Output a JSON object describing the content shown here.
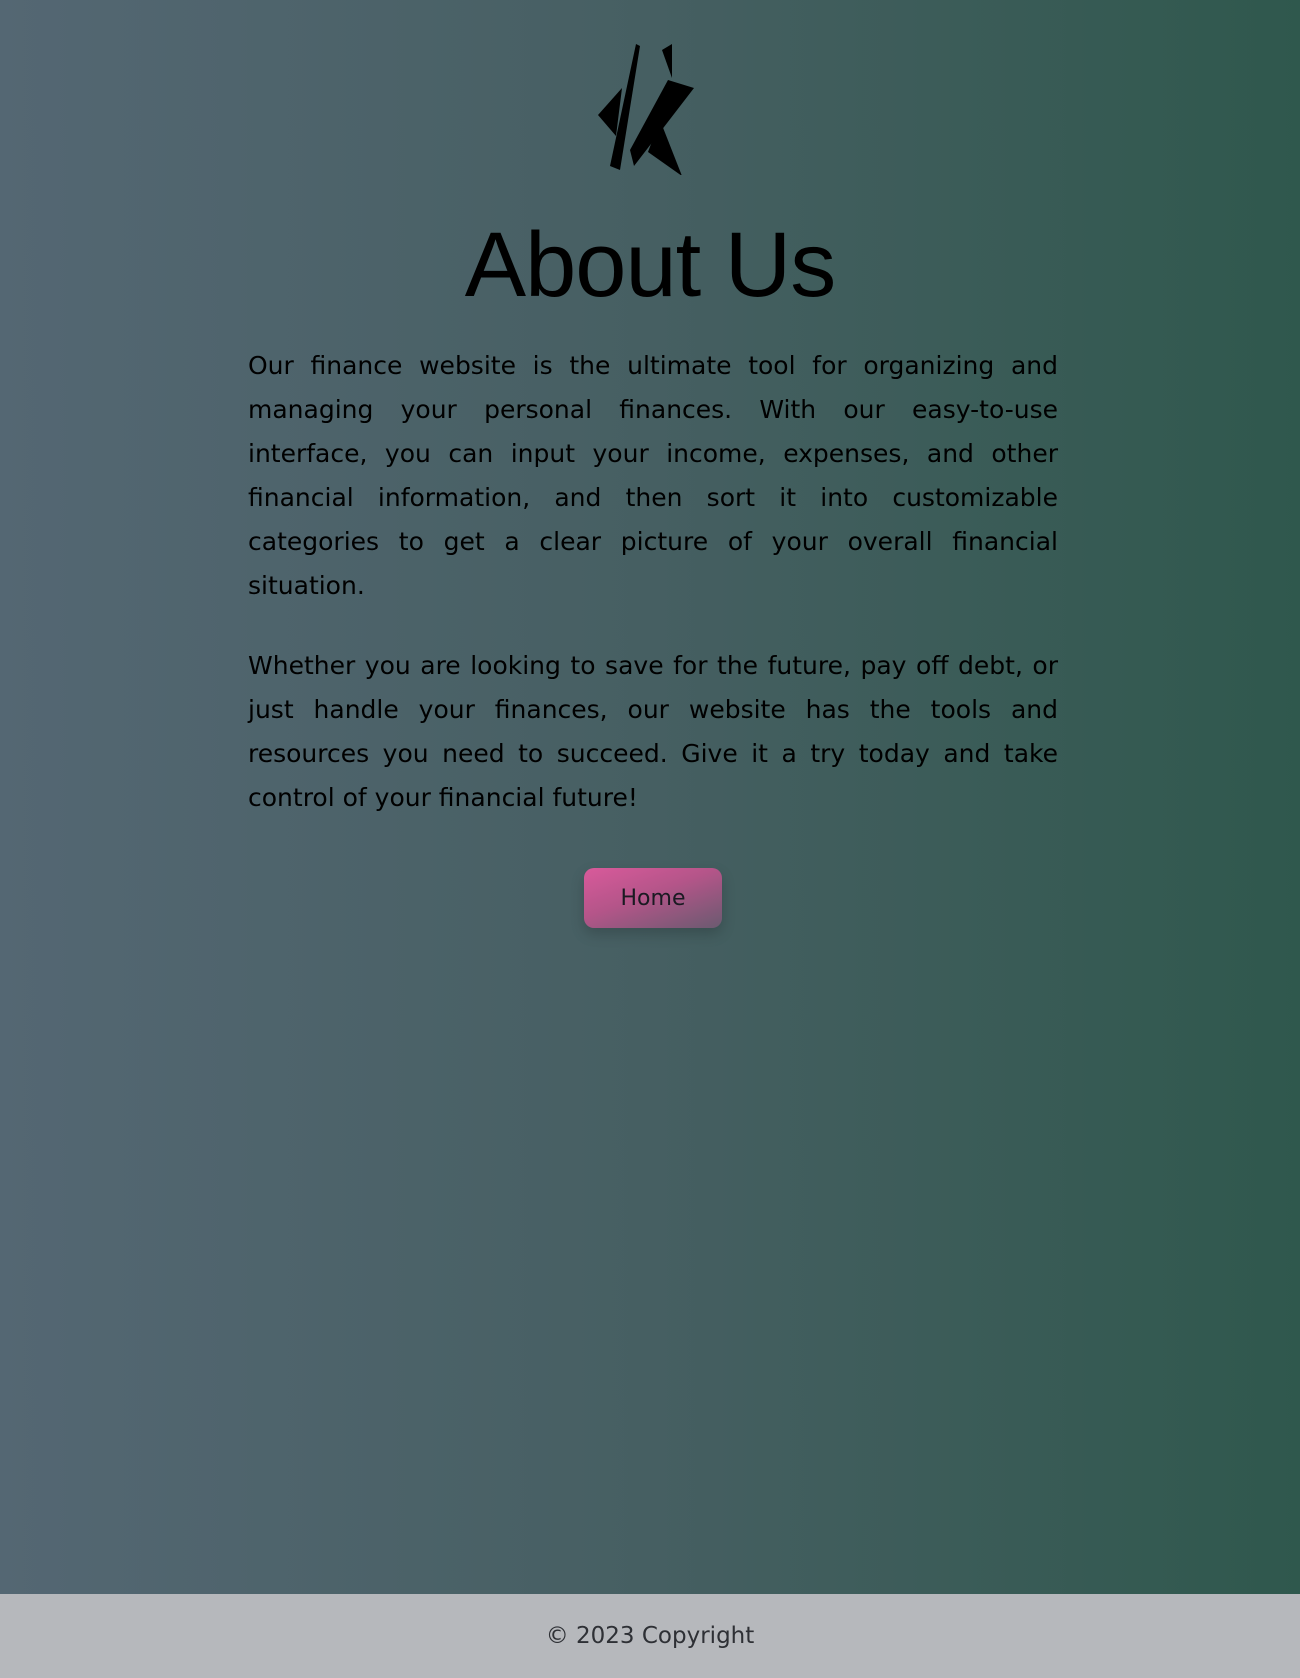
{
  "brand": {
    "logo_icon": "stylized-lightning-logo-icon"
  },
  "page": {
    "title": "About Us",
    "paragraphs": [
      "Our finance website is the ultimate tool for organizing and managing your personal finances. With our easy-to-use interface, you can input your income, expenses, and other financial information, and then sort it into customizable categories to get a clear picture of your overall financial situation.",
      "Whether you are looking to save for the future, pay off debt, or just handle your finances, our website has the tools and resources you need to succeed. Give it a try today and take control of your financial future!"
    ]
  },
  "actions": {
    "home_label": "Home"
  },
  "footer": {
    "copyright": "© 2023 Copyright"
  },
  "colors": {
    "background_start": "#546773",
    "background_end": "#2f584d",
    "button_accent": "#d95a9b",
    "footer_bg": "#b6b8bc"
  }
}
